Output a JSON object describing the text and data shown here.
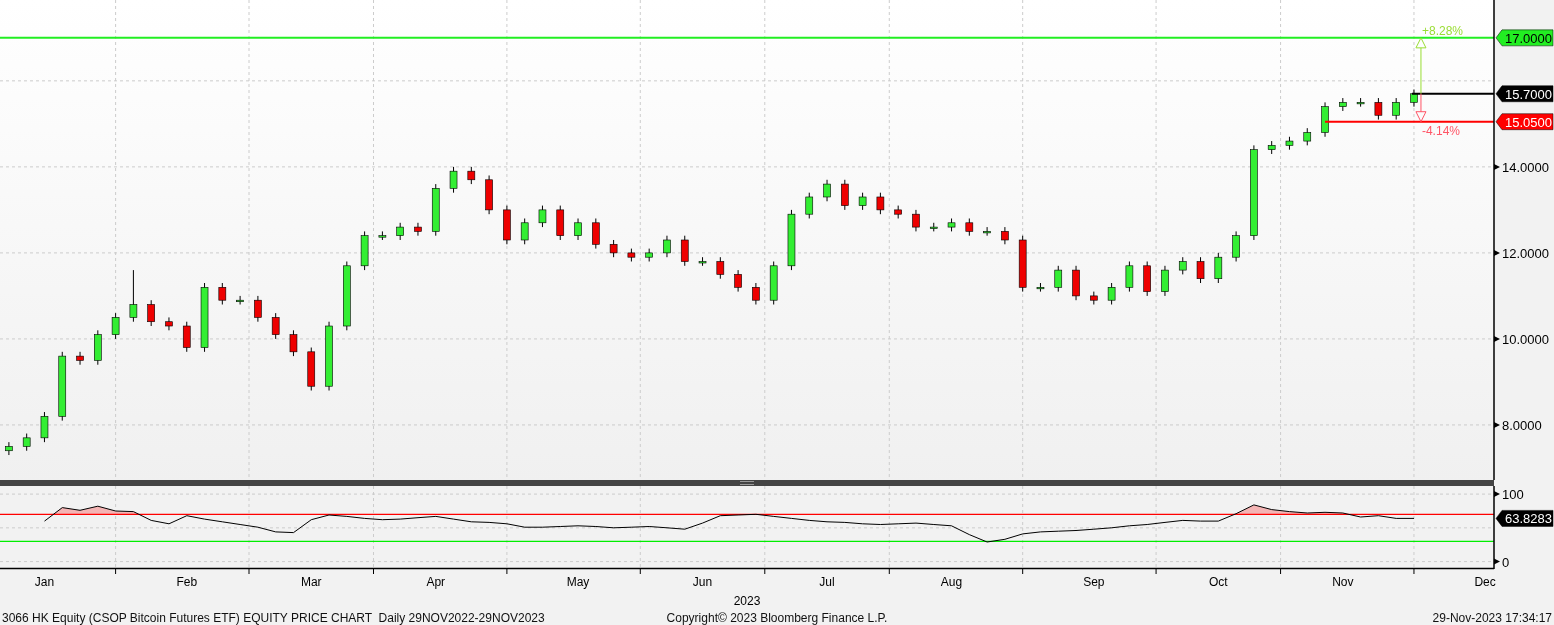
{
  "price_chart": {
    "chart_data": {
      "type": "candlestick",
      "ylim": [
        6.65,
        17.88
      ],
      "grid": true,
      "yticks": [
        {
          "value": 8,
          "label": "8.0000"
        },
        {
          "value": 10,
          "label": "10.0000"
        },
        {
          "value": 12,
          "label": "12.0000"
        },
        {
          "value": 14,
          "label": "14.0000"
        }
      ],
      "categories": [
        null,
        null,
        null,
        null,
        null,
        null,
        null,
        null,
        null,
        null,
        null,
        null,
        null,
        null,
        null,
        null,
        null,
        null,
        null,
        null,
        null,
        null,
        null,
        null,
        null,
        null,
        null,
        null,
        null,
        null,
        null,
        null,
        null,
        null,
        null,
        null,
        null,
        null,
        null,
        null,
        null,
        null,
        null,
        null,
        null,
        null,
        null,
        null,
        null,
        null,
        null,
        null,
        null,
        null,
        null,
        null,
        null,
        null,
        null,
        null,
        null,
        null,
        null,
        null,
        null,
        null,
        null,
        null,
        null,
        null,
        null,
        null,
        null,
        null,
        null,
        null,
        null,
        null,
        null,
        null,
        null,
        null,
        null,
        null
      ],
      "ohlc": [
        [
          7.4,
          7.6,
          7.3,
          7.5
        ],
        [
          7.5,
          7.8,
          7.4,
          7.7
        ],
        [
          7.7,
          8.3,
          7.6,
          8.2
        ],
        [
          8.2,
          9.7,
          8.1,
          9.6
        ],
        [
          9.6,
          9.7,
          9.4,
          9.5
        ],
        [
          9.5,
          10.2,
          9.4,
          10.1
        ],
        [
          10.1,
          10.6,
          10.0,
          10.5
        ],
        [
          10.5,
          11.6,
          10.4,
          10.8
        ],
        [
          10.8,
          10.9,
          10.3,
          10.4
        ],
        [
          10.4,
          10.5,
          10.2,
          10.3
        ],
        [
          10.3,
          10.4,
          9.7,
          9.8
        ],
        [
          9.8,
          11.3,
          9.7,
          11.2
        ],
        [
          11.2,
          11.3,
          10.8,
          10.9
        ],
        [
          10.9,
          11.0,
          10.8,
          10.9
        ],
        [
          10.9,
          11.0,
          10.4,
          10.5
        ],
        [
          10.5,
          10.6,
          10.0,
          10.1
        ],
        [
          10.1,
          10.2,
          9.6,
          9.7
        ],
        [
          9.7,
          9.8,
          8.8,
          8.9
        ],
        [
          8.9,
          10.4,
          8.8,
          10.3
        ],
        [
          10.3,
          11.8,
          10.2,
          11.7
        ],
        [
          11.7,
          12.5,
          11.6,
          12.4
        ],
        [
          12.4,
          12.5,
          12.3,
          12.4
        ],
        [
          12.4,
          12.7,
          12.3,
          12.6
        ],
        [
          12.6,
          12.7,
          12.4,
          12.5
        ],
        [
          12.5,
          13.6,
          12.4,
          13.5
        ],
        [
          13.5,
          14.0,
          13.4,
          13.9
        ],
        [
          13.9,
          14.0,
          13.6,
          13.7
        ],
        [
          13.7,
          13.8,
          12.9,
          13.0
        ],
        [
          13.0,
          13.1,
          12.2,
          12.3
        ],
        [
          12.3,
          12.8,
          12.2,
          12.7
        ],
        [
          12.7,
          13.1,
          12.6,
          13.0
        ],
        [
          13.0,
          13.1,
          12.3,
          12.4
        ],
        [
          12.4,
          12.8,
          12.3,
          12.7
        ],
        [
          12.7,
          12.8,
          12.1,
          12.2
        ],
        [
          12.2,
          12.3,
          11.9,
          12.0
        ],
        [
          12.0,
          12.1,
          11.8,
          11.9
        ],
        [
          11.9,
          12.1,
          11.8,
          12.0
        ],
        [
          12.0,
          12.4,
          11.9,
          12.3
        ],
        [
          12.3,
          12.4,
          11.7,
          11.8
        ],
        [
          11.8,
          11.9,
          11.7,
          11.8
        ],
        [
          11.8,
          11.9,
          11.4,
          11.5
        ],
        [
          11.5,
          11.6,
          11.1,
          11.2
        ],
        [
          11.2,
          11.3,
          10.8,
          10.9
        ],
        [
          10.9,
          11.8,
          10.8,
          11.7
        ],
        [
          11.7,
          13.0,
          11.6,
          12.9
        ],
        [
          12.9,
          13.4,
          12.8,
          13.3
        ],
        [
          13.3,
          13.7,
          13.2,
          13.6
        ],
        [
          13.6,
          13.7,
          13.0,
          13.1
        ],
        [
          13.1,
          13.4,
          13.0,
          13.3
        ],
        [
          13.3,
          13.4,
          12.9,
          13.0
        ],
        [
          13.0,
          13.1,
          12.8,
          12.9
        ],
        [
          12.9,
          13.0,
          12.5,
          12.6
        ],
        [
          12.6,
          12.7,
          12.5,
          12.6
        ],
        [
          12.6,
          12.8,
          12.5,
          12.7
        ],
        [
          12.7,
          12.8,
          12.4,
          12.5
        ],
        [
          12.5,
          12.6,
          12.4,
          12.5
        ],
        [
          12.5,
          12.6,
          12.2,
          12.3
        ],
        [
          12.3,
          12.4,
          11.1,
          11.2
        ],
        [
          11.2,
          11.3,
          11.1,
          11.2
        ],
        [
          11.2,
          11.7,
          11.1,
          11.6
        ],
        [
          11.6,
          11.7,
          10.9,
          11.0
        ],
        [
          11.0,
          11.1,
          10.8,
          10.9
        ],
        [
          10.9,
          11.3,
          10.8,
          11.2
        ],
        [
          11.2,
          11.8,
          11.1,
          11.7
        ],
        [
          11.7,
          11.8,
          11.0,
          11.1
        ],
        [
          11.1,
          11.7,
          11.0,
          11.6
        ],
        [
          11.6,
          11.9,
          11.5,
          11.8
        ],
        [
          11.8,
          11.9,
          11.3,
          11.4
        ],
        [
          11.4,
          12.0,
          11.3,
          11.9
        ],
        [
          11.9,
          12.5,
          11.8,
          12.4
        ],
        [
          12.4,
          14.5,
          12.3,
          14.4
        ],
        [
          14.4,
          14.6,
          14.3,
          14.5
        ],
        [
          14.5,
          14.7,
          14.4,
          14.6
        ],
        [
          14.6,
          14.9,
          14.5,
          14.8
        ],
        [
          14.8,
          15.5,
          14.7,
          15.4
        ],
        [
          15.4,
          15.6,
          15.3,
          15.5
        ],
        [
          15.5,
          15.6,
          15.4,
          15.5
        ],
        [
          15.5,
          15.6,
          15.1,
          15.2
        ],
        [
          15.2,
          15.6,
          15.1,
          15.5
        ],
        [
          15.5,
          15.8,
          15.4,
          15.7
        ],
        null,
        null,
        null,
        null
      ],
      "ref_lines": [
        {
          "axis": "y",
          "value": 17,
          "label": "17.0000",
          "color": "#22ee22"
        },
        {
          "axis": "y",
          "value": 15.7,
          "label": "15.7000",
          "color": "#000000"
        },
        {
          "axis": "y",
          "value": 15.05,
          "label": "15.0500",
          "color": "#ff0000"
        }
      ]
    },
    "change_labels": [
      {
        "label": "+8.28%",
        "color": "#99dd33"
      },
      {
        "label": "-4.14%",
        "color": "#ff5566"
      }
    ]
  },
  "rsi_chart": {
    "chart_data": {
      "type": "line",
      "ylim": [
        -11,
        112
      ],
      "grid": true,
      "yticks": [
        {
          "value": 0,
          "label": "0"
        },
        {
          "value": 100,
          "label": "100"
        }
      ],
      "categories": [
        null,
        null,
        "Jan",
        null,
        null,
        null,
        null,
        null,
        null,
        null,
        "Feb",
        null,
        null,
        null,
        null,
        null,
        null,
        "Mar",
        null,
        null,
        null,
        null,
        null,
        null,
        "Apr",
        null,
        null,
        null,
        null,
        null,
        null,
        null,
        "May",
        null,
        null,
        null,
        null,
        null,
        null,
        "Jun",
        null,
        null,
        null,
        null,
        null,
        null,
        "Jul",
        null,
        null,
        null,
        null,
        null,
        null,
        "Aug",
        null,
        null,
        null,
        null,
        null,
        null,
        null,
        "Sep",
        null,
        null,
        null,
        null,
        null,
        null,
        "Oct",
        null,
        null,
        null,
        null,
        null,
        null,
        "Nov",
        null,
        null,
        null,
        null,
        null,
        null,
        null,
        "Dec"
      ],
      "series": [
        {
          "color": "#000000",
          "values": [
            null,
            null,
            60,
            80,
            76,
            82,
            75,
            74,
            61,
            56,
            68,
            63,
            59,
            55,
            51,
            44,
            43,
            62,
            69,
            67,
            64,
            62,
            63,
            65,
            67,
            63,
            59,
            58,
            56,
            51,
            51,
            52,
            53,
            52,
            50,
            51,
            52,
            50,
            48,
            57,
            68,
            69,
            70,
            67,
            64,
            61,
            59,
            58,
            56,
            55,
            56,
            57,
            55,
            53,
            40,
            29,
            33,
            41,
            44,
            45,
            46,
            48,
            50,
            53,
            55,
            58,
            61,
            60,
            60,
            71,
            84,
            77,
            74,
            72,
            73,
            72,
            66,
            68,
            64,
            64,
            null,
            null,
            null,
            null
          ]
        }
      ],
      "ref_lines": [
        {
          "axis": "y",
          "value": 70,
          "color": "#ff0000"
        },
        {
          "axis": "y",
          "value": 30,
          "color": "#00ee00"
        }
      ]
    },
    "current_value": "63.8283"
  },
  "year_label": "2023",
  "footer": {
    "title": "3066 HK Equity (CSOP Bitcoin Futures ETF) EQUITY PRICE CHART  Daily 29NOV2022-29NOV2023",
    "copyright": "Copyright© 2023 Bloomberg Finance L.P.",
    "timestamp": "29-Nov-2023 17:34:17"
  }
}
